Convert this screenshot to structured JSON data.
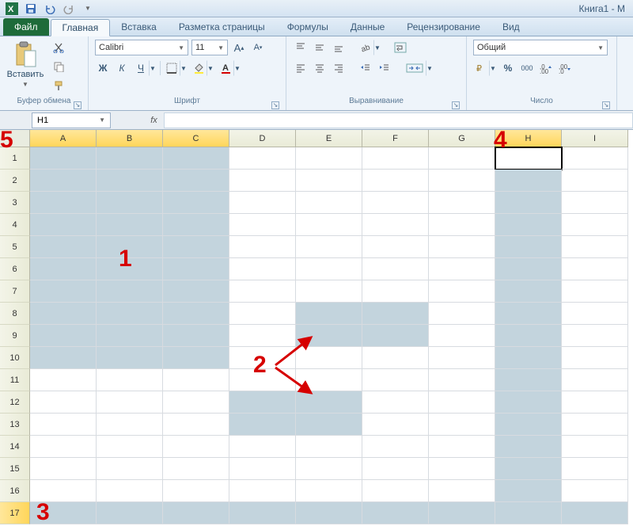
{
  "title": "Книга1 - M",
  "tabs": {
    "file": "Файл",
    "items": [
      "Главная",
      "Вставка",
      "Разметка страницы",
      "Формулы",
      "Данные",
      "Рецензирование",
      "Вид"
    ],
    "active": 0
  },
  "ribbon": {
    "clipboard": {
      "label": "Буфер обмена",
      "paste": "Вставить"
    },
    "font": {
      "label": "Шрифт",
      "name": "Calibri",
      "size": "11",
      "bold": "Ж",
      "italic": "К",
      "underline": "Ч"
    },
    "alignment": {
      "label": "Выравнивание"
    },
    "number": {
      "label": "Число",
      "format": "Общий",
      "percent": "%",
      "comma": "000",
      "inc": ",0←",
      "dec": ",0→"
    }
  },
  "formula_bar": {
    "name_box": "H1",
    "fx": "fx",
    "formula": ""
  },
  "grid": {
    "columns": [
      "A",
      "B",
      "C",
      "D",
      "E",
      "F",
      "G",
      "H",
      "I"
    ],
    "rows": [
      "1",
      "2",
      "3",
      "4",
      "5",
      "6",
      "7",
      "8",
      "9",
      "10",
      "11",
      "12",
      "13",
      "14",
      "15",
      "16",
      "17"
    ],
    "selected_col_idx": [
      0,
      1,
      2,
      7
    ],
    "selected_row_idx": [
      16
    ],
    "active_cell": "H1",
    "selection_blocks": [
      {
        "r0": 0,
        "r1": 9,
        "c0": 0,
        "c1": 2
      },
      {
        "r0": 7,
        "r1": 8,
        "c0": 4,
        "c1": 5
      },
      {
        "r0": 11,
        "r1": 12,
        "c0": 3,
        "c1": 4
      },
      {
        "r0": 0,
        "r1": 16,
        "c0": 7,
        "c1": 7
      },
      {
        "r0": 16,
        "r1": 16,
        "c0": 0,
        "c1": 8
      }
    ]
  },
  "annotations": {
    "a1": "1",
    "a2": "2",
    "a3": "3",
    "a4": "4",
    "a5": "5"
  }
}
